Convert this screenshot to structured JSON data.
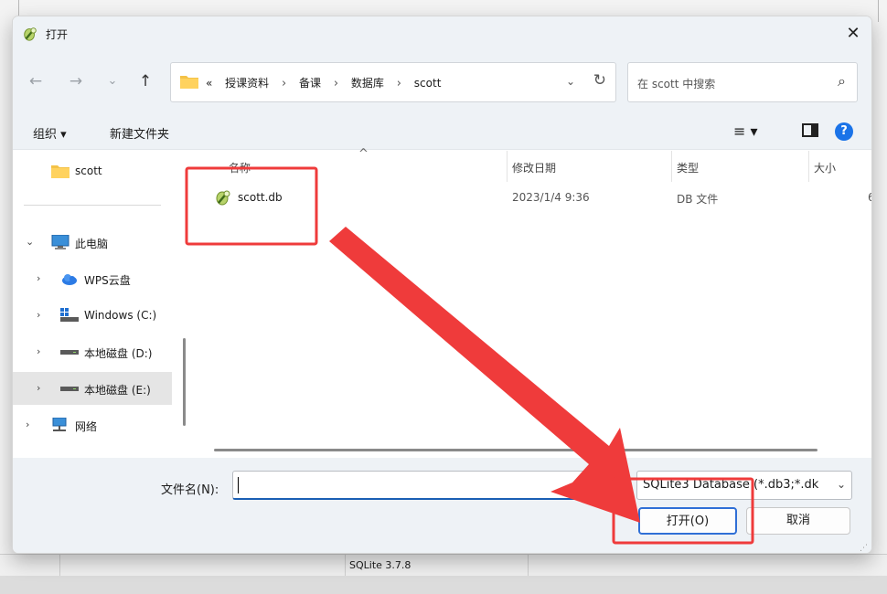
{
  "window": {
    "title": "打开",
    "close_label": "✕"
  },
  "nav": {
    "back_icon": "←",
    "forward_icon": "→",
    "recent_icon": "⌄",
    "up_icon": "↑",
    "breadcrumb": {
      "prefix": "«",
      "parts": [
        "授课资料",
        "备课",
        "数据库",
        "scott"
      ],
      "sep": "›"
    },
    "dropdown_icon": "⌄",
    "refresh_icon": "↻",
    "search_placeholder": "在 scott 中搜索",
    "search_icon": "⌕"
  },
  "toolbar": {
    "organize": "组织 ▾",
    "new_folder": "新建文件夹",
    "view_icon": "≡ ▾",
    "help_icon": "?"
  },
  "sidebar": {
    "items": [
      {
        "label": "scott",
        "icon": "folder-icon"
      },
      {
        "label": "此电脑",
        "icon": "computer-icon"
      },
      {
        "label": "WPS云盘",
        "icon": "cloud-icon"
      },
      {
        "label": "Windows (C:)",
        "icon": "drive-icon"
      },
      {
        "label": "本地磁盘 (D:)",
        "icon": "drive-icon"
      },
      {
        "label": "本地磁盘 (E:)",
        "icon": "drive-icon"
      },
      {
        "label": "网络",
        "icon": "network-icon"
      }
    ]
  },
  "filelist": {
    "columns": [
      "名称",
      "修改日期",
      "类型",
      "大小"
    ],
    "sort_icon": "^",
    "rows": [
      {
        "name": "scott.db",
        "modified": "2023/1/4 9:36",
        "type": "DB 文件",
        "size": "6"
      }
    ]
  },
  "footer": {
    "filename_label": "文件名(N):",
    "filename_value": "",
    "filetype": "SQLite3 Database (*.db3;*.dk",
    "open_label": "打开(O)",
    "cancel_label": "取消"
  },
  "background": {
    "status_version": "SQLite 3.7.8"
  },
  "colors": {
    "annotation": "#ef3b3b",
    "accent": "#1a73e8"
  }
}
